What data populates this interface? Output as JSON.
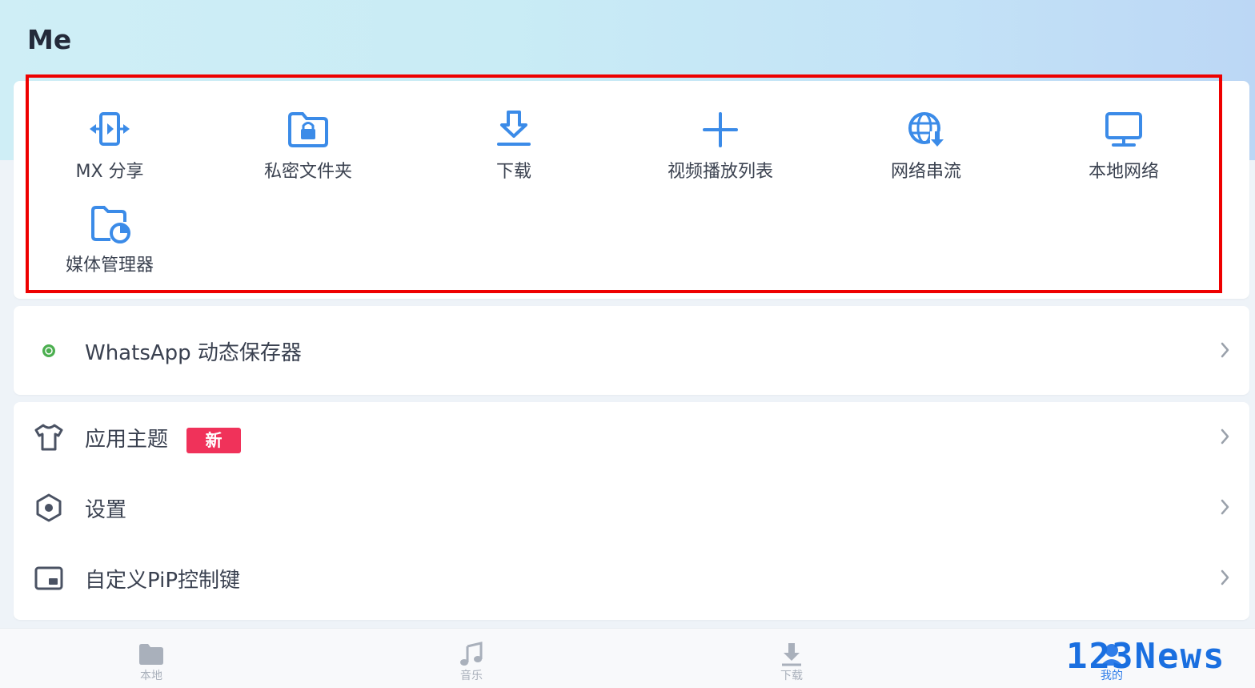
{
  "page": {
    "title": "Me"
  },
  "grid": {
    "items": [
      {
        "label": "MX 分享",
        "icon": "mx-share-icon"
      },
      {
        "label": "私密文件夹",
        "icon": "private-folder-icon"
      },
      {
        "label": "下载",
        "icon": "download-icon"
      },
      {
        "label": "视频播放列表",
        "icon": "add-playlist-icon"
      },
      {
        "label": "网络串流",
        "icon": "network-stream-icon"
      },
      {
        "label": "本地网络",
        "icon": "local-network-icon"
      },
      {
        "label": "媒体管理器",
        "icon": "media-manager-icon"
      }
    ]
  },
  "whatsapp": {
    "label": "WhatsApp 动态保存器",
    "icon": "whatsapp-icon"
  },
  "settings": {
    "items": [
      {
        "label": "应用主题",
        "icon": "tshirt-icon",
        "badge": "新"
      },
      {
        "label": "设置",
        "icon": "settings-icon"
      },
      {
        "label": "自定义PiP控制键",
        "icon": "pip-icon"
      }
    ]
  },
  "bottom_nav": {
    "items": [
      {
        "label": "本地",
        "icon": "folder-icon",
        "active": false
      },
      {
        "label": "音乐",
        "icon": "music-icon",
        "active": false
      },
      {
        "label": "下载",
        "icon": "download-icon",
        "active": false
      },
      {
        "label": "我的",
        "icon": "profile-icon",
        "active": true
      }
    ]
  },
  "watermark": {
    "text": "123News"
  },
  "colors": {
    "accent": "#2f7de9",
    "icon_blue": "#3b8be8",
    "badge": "#f0325a",
    "highlight": "#ee0000",
    "whatsapp": "#4caf50"
  }
}
